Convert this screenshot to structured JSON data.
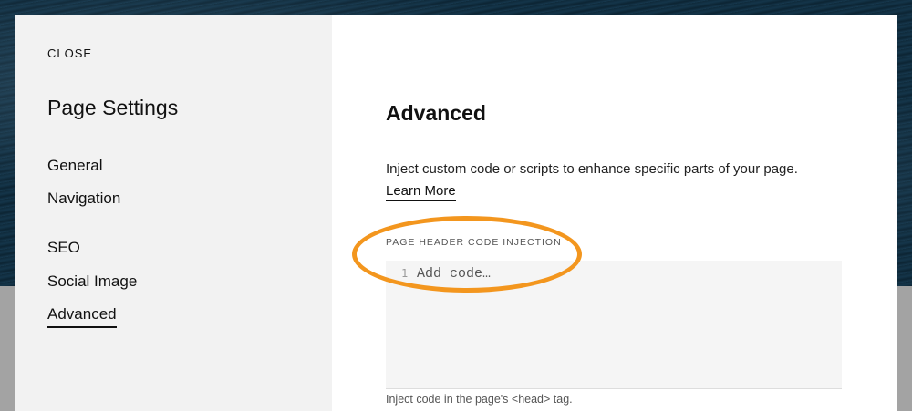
{
  "sidebar": {
    "close_label": "CLOSE",
    "title": "Page Settings",
    "items": [
      {
        "label": "General"
      },
      {
        "label": "Navigation"
      },
      {
        "label": "SEO"
      },
      {
        "label": "Social Image"
      },
      {
        "label": "Advanced",
        "active": true
      }
    ]
  },
  "content": {
    "title": "Advanced",
    "description": "Inject custom code or scripts to enhance specific parts of your page.",
    "learn_more": "Learn More",
    "field": {
      "label": "PAGE HEADER CODE INJECTION",
      "line_number": "1",
      "placeholder": "Add code…",
      "helper": "Inject code in the page's <head> tag."
    }
  },
  "annotation": {
    "highlight_color": "#f3961e"
  }
}
